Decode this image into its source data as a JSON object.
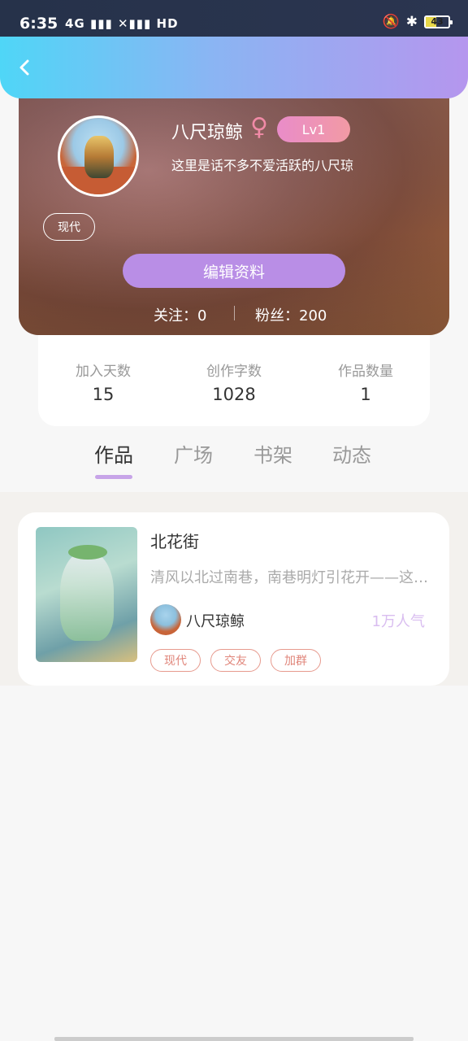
{
  "status_bar": {
    "time": "6:35",
    "signal": "4G ▮▮▮ ✕▮▮▮ HD",
    "battery": "43"
  },
  "profile": {
    "name": "八尺琼鲸",
    "gender_symbol": "♀",
    "level": "Lv1",
    "bio": "这里是话不多不爱活跃的八尺琼",
    "tag": "现代",
    "edit_label": "编辑资料",
    "following": "关注：0",
    "followers": "粉丝：200"
  },
  "stats": [
    {
      "label": "加入天数",
      "value": "15"
    },
    {
      "label": "创作字数",
      "value": "1028"
    },
    {
      "label": "作品数量",
      "value": "1"
    }
  ],
  "tabs": [
    "作品",
    "广场",
    "书架",
    "动态"
  ],
  "work": {
    "title": "北花街",
    "description": "清风以北过南巷，南巷明灯引花开——这…",
    "author": "八尺琼鲸",
    "popularity": "1万人气",
    "tags": [
      "现代",
      "交友",
      "加群"
    ]
  },
  "colors": {
    "header_gradient_start": "#4fd6f7",
    "header_gradient_end": "#b596ee",
    "accent_purple": "#b98ee6",
    "tag_color": "#e0857a"
  }
}
